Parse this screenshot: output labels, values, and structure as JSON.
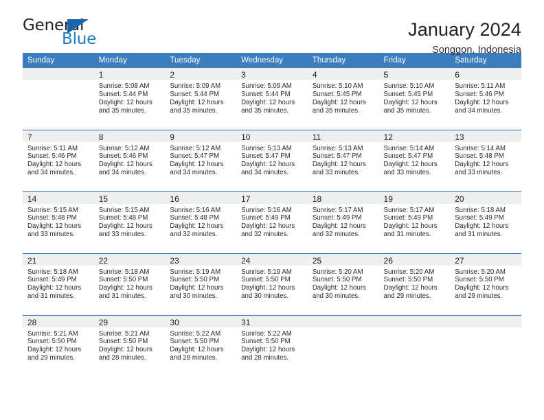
{
  "brand": {
    "name_part1": "General",
    "name_part2": "Blue",
    "accent_color": "#1f7bc1",
    "triangle_color": "#1566ad"
  },
  "header": {
    "title": "January 2024",
    "subtitle": "Songgon, Indonesia"
  },
  "theme": {
    "header_bg": "#3b7dbf",
    "header_text": "#ffffff",
    "row_divider": "#2f6fad",
    "daynum_band_bg": "#eef0f0"
  },
  "calendar": {
    "weekday_headers": [
      "Sunday",
      "Monday",
      "Tuesday",
      "Wednesday",
      "Thursday",
      "Friday",
      "Saturday"
    ],
    "weeks": [
      [
        {
          "day": "",
          "sunrise": "",
          "sunset": "",
          "daylight": "",
          "daylight2": "",
          "empty": true
        },
        {
          "day": "1",
          "sunrise": "Sunrise: 5:08 AM",
          "sunset": "Sunset: 5:44 PM",
          "daylight": "Daylight: 12 hours",
          "daylight2": "and 35 minutes.",
          "empty": false
        },
        {
          "day": "2",
          "sunrise": "Sunrise: 5:09 AM",
          "sunset": "Sunset: 5:44 PM",
          "daylight": "Daylight: 12 hours",
          "daylight2": "and 35 minutes.",
          "empty": false
        },
        {
          "day": "3",
          "sunrise": "Sunrise: 5:09 AM",
          "sunset": "Sunset: 5:44 PM",
          "daylight": "Daylight: 12 hours",
          "daylight2": "and 35 minutes.",
          "empty": false
        },
        {
          "day": "4",
          "sunrise": "Sunrise: 5:10 AM",
          "sunset": "Sunset: 5:45 PM",
          "daylight": "Daylight: 12 hours",
          "daylight2": "and 35 minutes.",
          "empty": false
        },
        {
          "day": "5",
          "sunrise": "Sunrise: 5:10 AM",
          "sunset": "Sunset: 5:45 PM",
          "daylight": "Daylight: 12 hours",
          "daylight2": "and 35 minutes.",
          "empty": false
        },
        {
          "day": "6",
          "sunrise": "Sunrise: 5:11 AM",
          "sunset": "Sunset: 5:46 PM",
          "daylight": "Daylight: 12 hours",
          "daylight2": "and 34 minutes.",
          "empty": false
        }
      ],
      [
        {
          "day": "7",
          "sunrise": "Sunrise: 5:11 AM",
          "sunset": "Sunset: 5:46 PM",
          "daylight": "Daylight: 12 hours",
          "daylight2": "and 34 minutes.",
          "empty": false
        },
        {
          "day": "8",
          "sunrise": "Sunrise: 5:12 AM",
          "sunset": "Sunset: 5:46 PM",
          "daylight": "Daylight: 12 hours",
          "daylight2": "and 34 minutes.",
          "empty": false
        },
        {
          "day": "9",
          "sunrise": "Sunrise: 5:12 AM",
          "sunset": "Sunset: 5:47 PM",
          "daylight": "Daylight: 12 hours",
          "daylight2": "and 34 minutes.",
          "empty": false
        },
        {
          "day": "10",
          "sunrise": "Sunrise: 5:13 AM",
          "sunset": "Sunset: 5:47 PM",
          "daylight": "Daylight: 12 hours",
          "daylight2": "and 34 minutes.",
          "empty": false
        },
        {
          "day": "11",
          "sunrise": "Sunrise: 5:13 AM",
          "sunset": "Sunset: 5:47 PM",
          "daylight": "Daylight: 12 hours",
          "daylight2": "and 33 minutes.",
          "empty": false
        },
        {
          "day": "12",
          "sunrise": "Sunrise: 5:14 AM",
          "sunset": "Sunset: 5:47 PM",
          "daylight": "Daylight: 12 hours",
          "daylight2": "and 33 minutes.",
          "empty": false
        },
        {
          "day": "13",
          "sunrise": "Sunrise: 5:14 AM",
          "sunset": "Sunset: 5:48 PM",
          "daylight": "Daylight: 12 hours",
          "daylight2": "and 33 minutes.",
          "empty": false
        }
      ],
      [
        {
          "day": "14",
          "sunrise": "Sunrise: 5:15 AM",
          "sunset": "Sunset: 5:48 PM",
          "daylight": "Daylight: 12 hours",
          "daylight2": "and 33 minutes.",
          "empty": false
        },
        {
          "day": "15",
          "sunrise": "Sunrise: 5:15 AM",
          "sunset": "Sunset: 5:48 PM",
          "daylight": "Daylight: 12 hours",
          "daylight2": "and 33 minutes.",
          "empty": false
        },
        {
          "day": "16",
          "sunrise": "Sunrise: 5:16 AM",
          "sunset": "Sunset: 5:48 PM",
          "daylight": "Daylight: 12 hours",
          "daylight2": "and 32 minutes.",
          "empty": false
        },
        {
          "day": "17",
          "sunrise": "Sunrise: 5:16 AM",
          "sunset": "Sunset: 5:49 PM",
          "daylight": "Daylight: 12 hours",
          "daylight2": "and 32 minutes.",
          "empty": false
        },
        {
          "day": "18",
          "sunrise": "Sunrise: 5:17 AM",
          "sunset": "Sunset: 5:49 PM",
          "daylight": "Daylight: 12 hours",
          "daylight2": "and 32 minutes.",
          "empty": false
        },
        {
          "day": "19",
          "sunrise": "Sunrise: 5:17 AM",
          "sunset": "Sunset: 5:49 PM",
          "daylight": "Daylight: 12 hours",
          "daylight2": "and 31 minutes.",
          "empty": false
        },
        {
          "day": "20",
          "sunrise": "Sunrise: 5:18 AM",
          "sunset": "Sunset: 5:49 PM",
          "daylight": "Daylight: 12 hours",
          "daylight2": "and 31 minutes.",
          "empty": false
        }
      ],
      [
        {
          "day": "21",
          "sunrise": "Sunrise: 5:18 AM",
          "sunset": "Sunset: 5:49 PM",
          "daylight": "Daylight: 12 hours",
          "daylight2": "and 31 minutes.",
          "empty": false
        },
        {
          "day": "22",
          "sunrise": "Sunrise: 5:18 AM",
          "sunset": "Sunset: 5:50 PM",
          "daylight": "Daylight: 12 hours",
          "daylight2": "and 31 minutes.",
          "empty": false
        },
        {
          "day": "23",
          "sunrise": "Sunrise: 5:19 AM",
          "sunset": "Sunset: 5:50 PM",
          "daylight": "Daylight: 12 hours",
          "daylight2": "and 30 minutes.",
          "empty": false
        },
        {
          "day": "24",
          "sunrise": "Sunrise: 5:19 AM",
          "sunset": "Sunset: 5:50 PM",
          "daylight": "Daylight: 12 hours",
          "daylight2": "and 30 minutes.",
          "empty": false
        },
        {
          "day": "25",
          "sunrise": "Sunrise: 5:20 AM",
          "sunset": "Sunset: 5:50 PM",
          "daylight": "Daylight: 12 hours",
          "daylight2": "and 30 minutes.",
          "empty": false
        },
        {
          "day": "26",
          "sunrise": "Sunrise: 5:20 AM",
          "sunset": "Sunset: 5:50 PM",
          "daylight": "Daylight: 12 hours",
          "daylight2": "and 29 minutes.",
          "empty": false
        },
        {
          "day": "27",
          "sunrise": "Sunrise: 5:20 AM",
          "sunset": "Sunset: 5:50 PM",
          "daylight": "Daylight: 12 hours",
          "daylight2": "and 29 minutes.",
          "empty": false
        }
      ],
      [
        {
          "day": "28",
          "sunrise": "Sunrise: 5:21 AM",
          "sunset": "Sunset: 5:50 PM",
          "daylight": "Daylight: 12 hours",
          "daylight2": "and 29 minutes.",
          "empty": false
        },
        {
          "day": "29",
          "sunrise": "Sunrise: 5:21 AM",
          "sunset": "Sunset: 5:50 PM",
          "daylight": "Daylight: 12 hours",
          "daylight2": "and 28 minutes.",
          "empty": false
        },
        {
          "day": "30",
          "sunrise": "Sunrise: 5:22 AM",
          "sunset": "Sunset: 5:50 PM",
          "daylight": "Daylight: 12 hours",
          "daylight2": "and 28 minutes.",
          "empty": false
        },
        {
          "day": "31",
          "sunrise": "Sunrise: 5:22 AM",
          "sunset": "Sunset: 5:50 PM",
          "daylight": "Daylight: 12 hours",
          "daylight2": "and 28 minutes.",
          "empty": false
        },
        {
          "day": "",
          "sunrise": "",
          "sunset": "",
          "daylight": "",
          "daylight2": "",
          "empty": true
        },
        {
          "day": "",
          "sunrise": "",
          "sunset": "",
          "daylight": "",
          "daylight2": "",
          "empty": true
        },
        {
          "day": "",
          "sunrise": "",
          "sunset": "",
          "daylight": "",
          "daylight2": "",
          "empty": true
        }
      ]
    ]
  }
}
